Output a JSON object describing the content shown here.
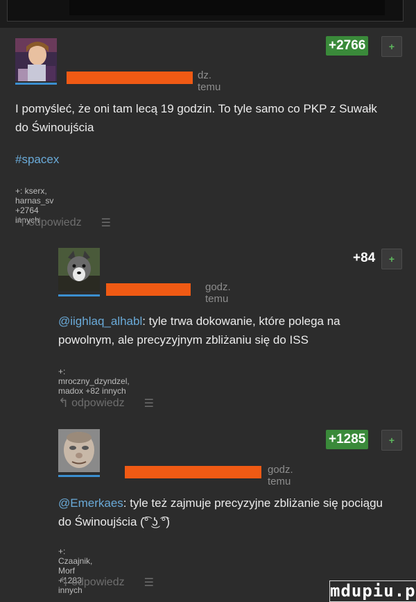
{
  "comments": [
    {
      "votes": "+2766",
      "plus": "+",
      "time": "dz. temu",
      "text": "I pomyśleć, że oni tam lecą 19 godzin. To tyle samo co PKP z Suwałk do Świnoujścia",
      "hashtag": "#spacex",
      "voters": "+: kserx, harnas_sv +2764 innych",
      "reply": "odpowiedz"
    },
    {
      "votes": "+84",
      "plus": "+",
      "time": "godz. temu",
      "mention": "@iighlaq_alhabl",
      "text": ": tyle trwa dokowanie, które polega na powolnym, ale precyzyjnym zbliżaniu się do ISS",
      "voters": "+: mroczny_dzyndzel, madox +82 innych",
      "reply": "odpowiedz"
    },
    {
      "votes": "+1285",
      "plus": "+",
      "time": "godz. temu",
      "mention": "@Emerkaes",
      "text": ": tyle też zajmuje precyzyjne zbliżanie się pociągu do Świnoujścia (͡° ͜ʖ ͡°)",
      "voters": "+: Czaajnik, Morf +1283 innych",
      "reply": "odpowiedz"
    }
  ],
  "watermark": "mdupiu.pl",
  "colors": {
    "background": "#2c2c2c",
    "accent_orange": "#f05a14",
    "link_blue": "#6aaad8",
    "vote_green": "#3a8a3a"
  }
}
